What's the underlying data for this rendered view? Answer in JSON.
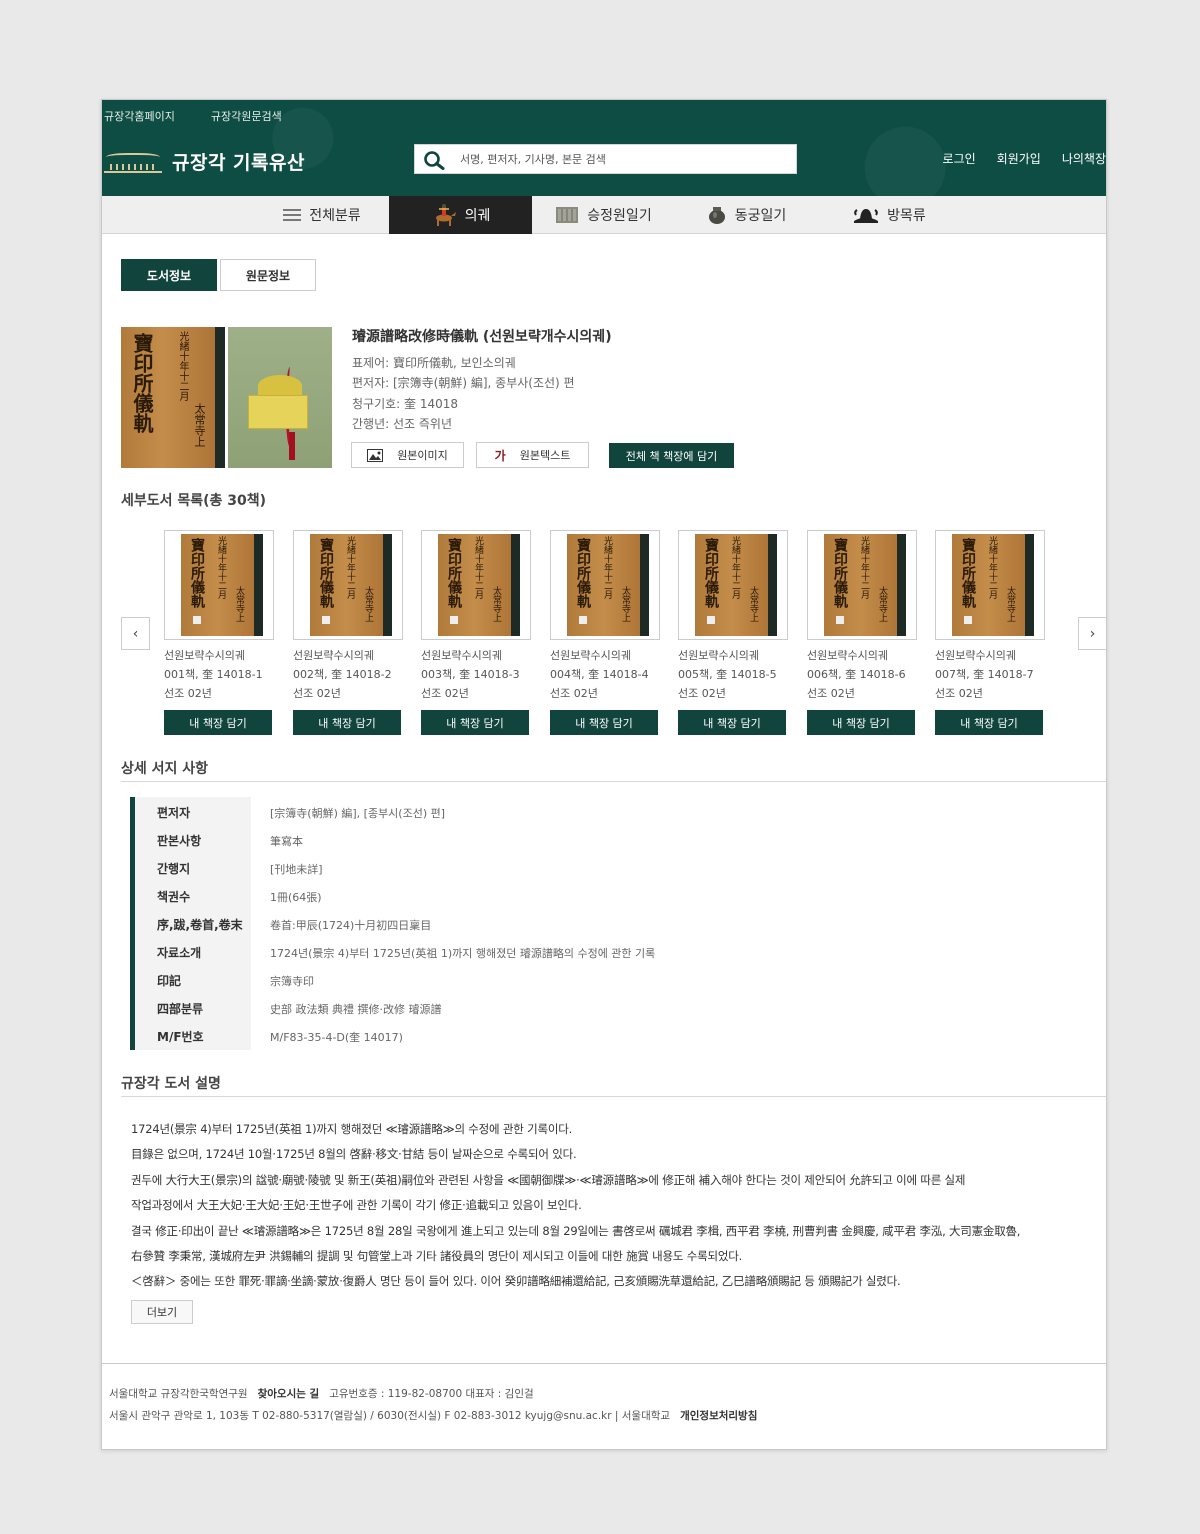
{
  "header": {
    "top_links": [
      "규장각홈페이지",
      "규장각원문검색"
    ],
    "logo_text": "규장각 기록유산",
    "search_placeholder": "서명, 편저자, 기사명, 본문 검색",
    "user_links": [
      "로그인",
      "회원가입",
      "나의책장"
    ]
  },
  "nav": {
    "items": [
      "전체분류",
      "의궤",
      "승정원일기",
      "동궁일기",
      "방목류"
    ],
    "active": "의궤"
  },
  "tabs": [
    "도서정보",
    "원문정보"
  ],
  "book": {
    "title": "璿源譜略改修時儀軌 (선원보략개수시의궤)",
    "cover_text": [
      "寶印所儀軌",
      "光緒十年十二月",
      "太常寺上"
    ],
    "meta": [
      "표제어: 寶印所儀軌, 보인소의궤",
      "편저자: [宗簿寺(朝鮮) 編], 종부사(조선) 편",
      "청구기호: 奎 14018",
      "간행년: 선조 즉위년"
    ],
    "buttons": {
      "image": "원본이미지",
      "text": "원본텍스트",
      "text_icon": "가",
      "add_all": "전체 책 책장에 담기"
    }
  },
  "volumes": {
    "title": "세부도서 목록(총 30책)",
    "prev": "‹",
    "next": "›",
    "add_label": "내 책장 담기",
    "items": [
      {
        "name": "선원보략수시의궤",
        "code": "001책, 奎 14018-1",
        "year": "선조 02년"
      },
      {
        "name": "선원보략수시의궤",
        "code": "002책, 奎 14018-2",
        "year": "선조 02년"
      },
      {
        "name": "선원보략수시의궤",
        "code": "003책, 奎 14018-3",
        "year": "선조 02년"
      },
      {
        "name": "선원보략수시의궤",
        "code": "004책, 奎 14018-4",
        "year": "선조 02년"
      },
      {
        "name": "선원보략수시의궤",
        "code": "005책, 奎 14018-5",
        "year": "선조 02년"
      },
      {
        "name": "선원보략수시의궤",
        "code": "006책, 奎 14018-6",
        "year": "선조 02년"
      },
      {
        "name": "선원보략수시의궤",
        "code": "007책, 奎 14018-7",
        "year": "선조 02년"
      }
    ]
  },
  "detail": {
    "title": "상세 서지 사항",
    "rows": [
      {
        "key": "편저자",
        "value": "[宗簿寺(朝鮮) 編],  [종부시(조선) 편]"
      },
      {
        "key": "판본사항",
        "value": "筆寫本"
      },
      {
        "key": "간행지",
        "value": "[刊地未詳]"
      },
      {
        "key": "책권수",
        "value": "1冊(64張)"
      },
      {
        "key": "序,跋,卷首,卷末",
        "value": "卷首:甲辰(1724)十月初四日稟目"
      },
      {
        "key": "자료소개",
        "value": "1724년(景宗 4)부터 1725년(英祖 1)까지 행해졌던 璿源譜略의 수정에 관한 기록"
      },
      {
        "key": "印記",
        "value": "宗簿寺印"
      },
      {
        "key": "四部분류",
        "value": "史部 政法類 典禮 撰修·改修 璿源譜"
      },
      {
        "key": "M/F번호",
        "value": "M/F83-35-4-D(奎 14017)"
      }
    ]
  },
  "description": {
    "title": "규장각 도서 설명",
    "lines": [
      "1724년(景宗 4)부터 1725년(英祖 1)까지 행해졌던 ≪璿源譜略≫의 수정에 관한 기록이다.",
      "目錄은 없으며, 1724년 10월·1725년 8월의 啓辭·移文·甘結 등이 날짜순으로 수록되어 있다.",
      "권두에 大行大王(景宗)의 諡號·廟號·陵號 및 新王(英祖)嗣位와 관련된 사항을 ≪國朝御牒≫·≪璿源譜略≫에 修正해 補入해야 한다는 것이 제안되어 允許되고 이에 따른 실제",
      "작업과정에서 大王大妃·王大妃·王妃·王世子에 관한 기록이 각기 修正·追載되고 있음이 보인다.",
      "결국 修正·印出이 끝난 ≪璿源譜略≫은 1725년 8월 28일 국왕에게 進上되고 있는데 8월 29일에는 書啓로써 礪城君 李楫, 西平君 李橈, 刑曹判書 金興慶, 咸平君 李泓, 大司憲金取魯,",
      "右參贊 李秉常, 漢城府左尹 洪錫輔의 提調 및 句管堂上과 기타 諸役員의 명단이 제시되고 이들에 대한 施賞 내용도 수록되었다.",
      "＜啓辭＞ 중에는 또한 罪死·罪謫·坐謫·蒙放·復爵人 명단 등이 들어 있다. 이어 癸卯譜略細補還給記, 己亥頒賜洗草還給記, 乙巳譜略頒賜記 등 頒賜記가 실렸다."
    ],
    "more": "더보기"
  },
  "footer": {
    "org": "서울대학교 규장각한국학연구원",
    "directions": "찾아오시는 길",
    "reg": "고유번호증 : 119-82-08700   대표자 : 김인걸",
    "address": "서울시 관악구 관악로 1, 103동  T 02-880-5317(열람실) / 6030(전시실) F 02-883-3012   kyujg@snu.ac.kr  |  서울대학교",
    "privacy": "개인정보처리방침"
  },
  "colors": {
    "header_bg": "#0e4d44",
    "accent": "#11443d",
    "nav_active": "#222222"
  },
  "icons": [
    "logo-mark-icon",
    "search-icon",
    "menu-icon",
    "horse-rider-icon",
    "book-stack-icon",
    "pot-icon",
    "hat-icon",
    "image-icon",
    "text-icon",
    "chevron-left-icon",
    "chevron-right-icon"
  ]
}
